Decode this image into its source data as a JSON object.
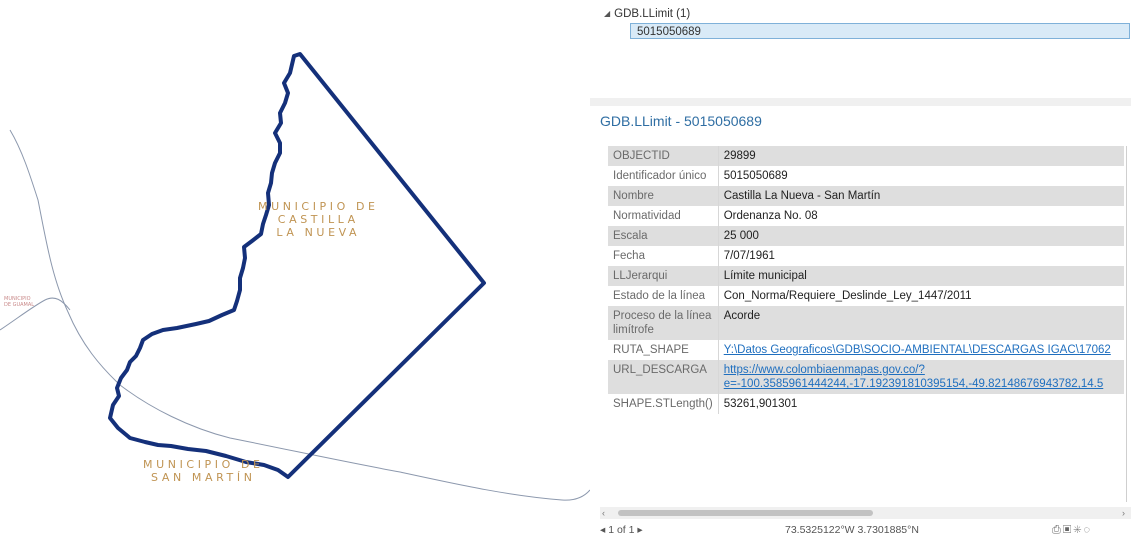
{
  "map": {
    "label_castilla": [
      "MUNICIPIO DE",
      "CASTILLA",
      "LA NUEVA"
    ],
    "label_san_martin": [
      "MUNICIPIO DE",
      "SAN MARTÍN"
    ],
    "label_small_left": [
      "MUNICIPIO",
      "DE GUAMAL"
    ],
    "colors": {
      "boundary": "#14307a",
      "river": "#8c98ad",
      "label": "#c09453"
    }
  },
  "tree": {
    "parent_label": "GDB.LLimit (1)",
    "child_label": "5015050689"
  },
  "popup": {
    "title": "GDB.LLimit - 5015050689",
    "rows": [
      {
        "key": "OBJECTID",
        "value": "29899"
      },
      {
        "key": "Identificador único",
        "value": "5015050689"
      },
      {
        "key": "Nombre",
        "value": "Castilla La Nueva - San Martín"
      },
      {
        "key": "Normatividad",
        "value": "Ordenanza No. 08"
      },
      {
        "key": "Escala",
        "value": "25 000"
      },
      {
        "key": "Fecha",
        "value": "7/07/1961"
      },
      {
        "key": "LLJerarqui",
        "value": "Límite municipal"
      },
      {
        "key": "Estado de la línea",
        "value": "Con_Norma/Requiere_Deslinde_Ley_1447/2011"
      },
      {
        "key": "Proceso de la línea limítrofe",
        "value": "Acorde"
      },
      {
        "key": "RUTA_SHAPE",
        "value": "Y:\\Datos Geograficos\\GDB\\SOCIO-AMBIENTAL\\DESCARGAS IGAC\\17062"
      },
      {
        "key": "URL_DESCARGA",
        "value": "https://www.colombiaenmapas.gov.co/?",
        "value2": "e=-100.3585961444244,-17.192391810395154,-49.82148676943782,14.5"
      },
      {
        "key": "SHAPE.STLength()",
        "value": "53261,901301"
      }
    ]
  },
  "status": {
    "page_nav": "◂ 1 of 1 ▸",
    "coordinates": "73.5325122°W 3.7301885°N"
  }
}
